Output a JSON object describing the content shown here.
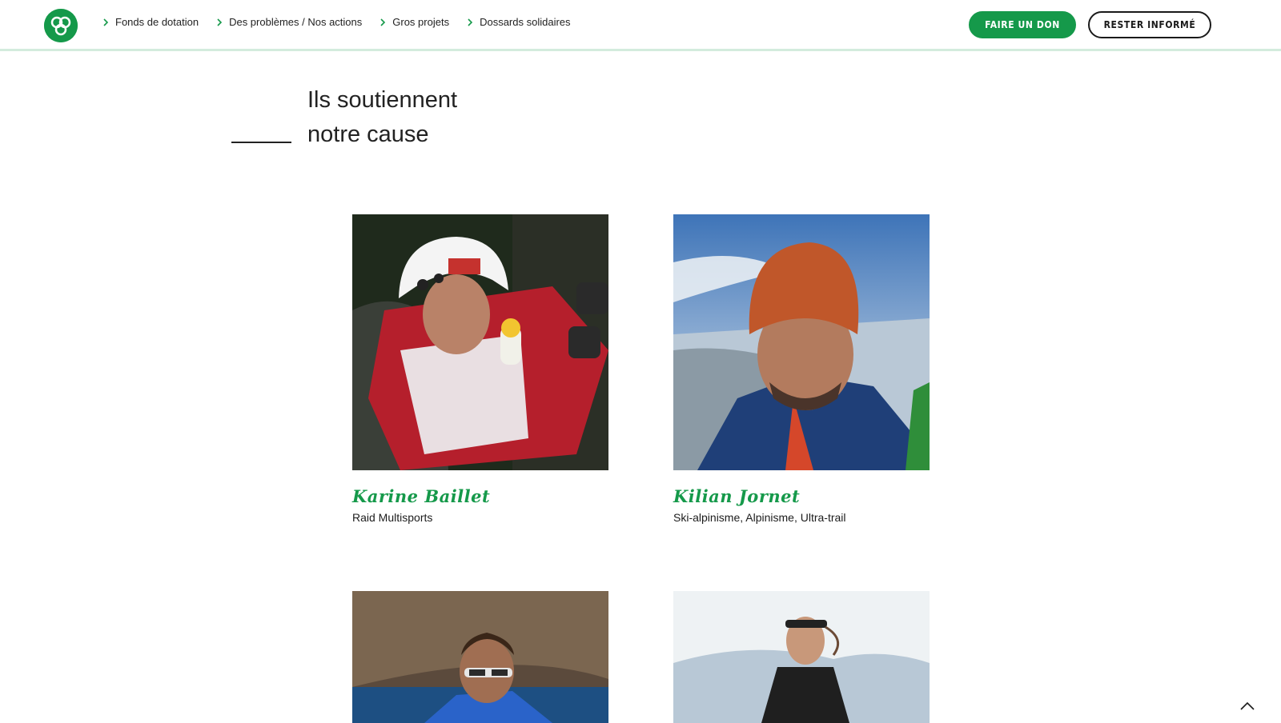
{
  "nav": {
    "items": [
      {
        "label": "Fonds de dotation"
      },
      {
        "label": "Des problèmes / Nos actions"
      },
      {
        "label": "Gros projets"
      },
      {
        "label": "Dossards solidaires"
      }
    ],
    "donate_label": "FAIRE UN DON",
    "subscribe_label": "RESTER INFORMÉ"
  },
  "section": {
    "title_line1": "Ils soutiennent",
    "title_line2": "notre cause"
  },
  "supporters": [
    {
      "name": "Karine Baillet",
      "sport": "Raid Multisports"
    },
    {
      "name": "Kilian Jornet",
      "sport": "Ski-alpinisme, Alpinisme, Ultra-trail"
    }
  ],
  "colors": {
    "brand_green": "#15994a",
    "header_rule": "#d3ecdd"
  },
  "icons": {
    "logo": "trefoil-logo-icon",
    "nav_chevron": "chevron-right-icon",
    "scroll_top": "chevron-up-icon"
  }
}
